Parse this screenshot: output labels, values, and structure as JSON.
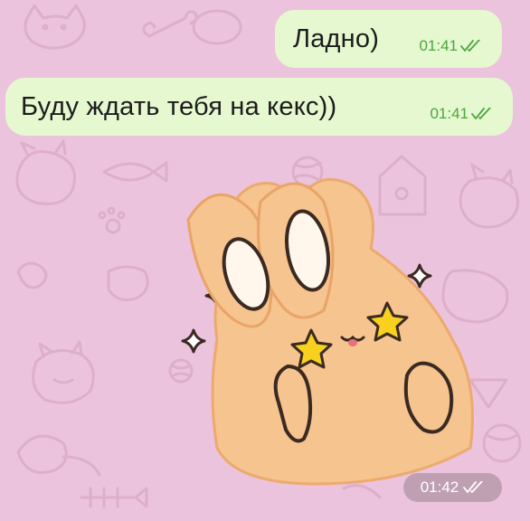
{
  "messages": [
    {
      "text": "Ладно)",
      "time": "01:41",
      "status_icon": "double-check-icon"
    },
    {
      "text": "Буду ждать тебя на кекс))",
      "time": "01:41",
      "status_icon": "double-check-icon"
    }
  ],
  "sticker": {
    "subject": "bunny-star-eyes-sticker",
    "time": "01:42",
    "status_icon": "double-check-icon"
  },
  "colors": {
    "wallpaper": "#ecc3dc",
    "outgoing_bubble": "#e6f8cf",
    "time_green": "#4aa63f",
    "sticker_time_pill": "#bfa0b3"
  }
}
